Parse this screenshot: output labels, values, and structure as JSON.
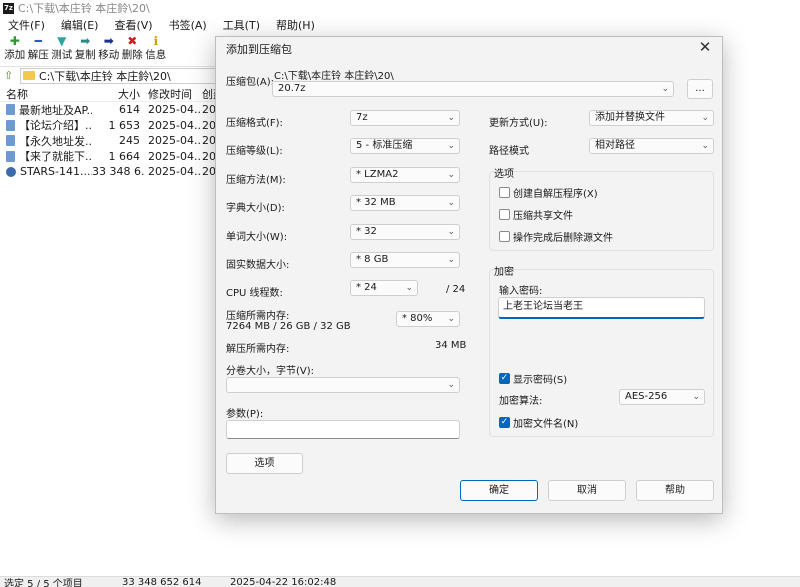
{
  "window": {
    "title": "C:\\下载\\本庄铃 本庄鈴\\20\\",
    "app_icon": "7z"
  },
  "menu": [
    "文件(F)",
    "编辑(E)",
    "查看(V)",
    "书签(A)",
    "工具(T)",
    "帮助(H)"
  ],
  "toolbar": [
    {
      "label": "添加",
      "icon": "plus-icon",
      "glyph": "✚",
      "color": "#2e9a2e"
    },
    {
      "label": "解压",
      "icon": "minus-icon",
      "glyph": "━",
      "color": "#2b57c4"
    },
    {
      "label": "测试",
      "icon": "check-icon",
      "glyph": "▼",
      "color": "#2aa6a0"
    },
    {
      "label": "复制",
      "icon": "copy-arrow-icon",
      "glyph": "➡",
      "color": "#2a8a8a"
    },
    {
      "label": "移动",
      "icon": "move-arrow-icon",
      "glyph": "➡",
      "color": "#1b2f8f"
    },
    {
      "label": "删除",
      "icon": "delete-icon",
      "glyph": "✖",
      "color": "#c62020"
    },
    {
      "label": "信息",
      "icon": "info-icon",
      "glyph": "ℹ",
      "color": "#c8a000"
    }
  ],
  "address": "C:\\下载\\本庄铃 本庄鈴\\20\\",
  "columns": {
    "name": "名称",
    "size": "大小",
    "modified": "修改时间",
    "created": "创建"
  },
  "files": [
    {
      "name": "最新地址及AP...",
      "size": "614",
      "modified": "2025-04...",
      "created": "20",
      "icon": "doc"
    },
    {
      "name": "【论坛介绍】....",
      "size": "1 653",
      "modified": "2025-04...",
      "created": "20",
      "icon": "doc"
    },
    {
      "name": "【永久地址发...",
      "size": "245",
      "modified": "2025-04...",
      "created": "20",
      "icon": "doc"
    },
    {
      "name": "【来了就能下...",
      "size": "1 664",
      "modified": "2025-04...",
      "created": "20",
      "icon": "doc"
    },
    {
      "name": "STARS-141....",
      "size": "33 348 6...",
      "modified": "2025-04...",
      "created": "20",
      "icon": "exe"
    }
  ],
  "status": {
    "selected": "选定 5 / 5 个项目",
    "size": "33 348 652 614",
    "time": "2025-04-22 16:02:48"
  },
  "dialog": {
    "title": "添加到压缩包",
    "archive_label": "压缩包(A):",
    "archive_path": "C:\\下载\\本庄铃 本庄鈴\\20\\",
    "archive_name": "20.7z",
    "browse_label": "...",
    "format_label": "压缩格式(F):",
    "format_value": "7z",
    "level_label": "压缩等级(L):",
    "level_value": "5 - 标准压缩",
    "method_label": "压缩方法(M):",
    "method_value": "* LZMA2",
    "dict_label": "字典大小(D):",
    "dict_value": "* 32 MB",
    "word_label": "单词大小(W):",
    "word_value": "* 32",
    "solid_label": "固实数据大小:",
    "solid_value": "* 8 GB",
    "threads_label": "CPU 线程数:",
    "threads_value": "* 24",
    "threads_max": "/ 24",
    "mem_label": "压缩所需内存:",
    "mem_detail": "7264 MB / 26 GB / 32 GB",
    "mem_percent": "* 80%",
    "decomp_label": "解压所需内存:",
    "decomp_value": "34 MB",
    "split_label": "分卷大小，字节(V):",
    "split_value": "",
    "params_label": "参数(P):",
    "params_value": "",
    "options_button": "选项",
    "update_label": "更新方式(U):",
    "update_value": "添加并替换文件",
    "path_label": "路径模式",
    "path_value": "相对路径",
    "options_group": "选项",
    "sfx_label": "创建自解压程序(X)",
    "shared_label": "压缩共享文件",
    "delete_label": "操作完成后删除源文件",
    "encrypt_group": "加密",
    "password_label": "输入密码:",
    "password_value": "上老王论坛当老王",
    "show_password_label": "显示密码(S)",
    "encrypt_method_label": "加密算法:",
    "encrypt_method_value": "AES-256",
    "encrypt_names_label": "加密文件名(N)",
    "ok_label": "确定",
    "cancel_label": "取消",
    "help_label": "帮助"
  }
}
